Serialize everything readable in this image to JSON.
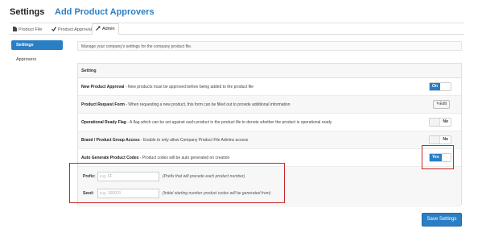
{
  "header": {
    "title": "Settings",
    "subtitle": "Add Product Approvers"
  },
  "tabs": [
    {
      "label": "Product File",
      "icon": "file-icon"
    },
    {
      "label": "Product Approval",
      "icon": "check-icon"
    },
    {
      "label": "Admin",
      "icon": "wrench-icon",
      "active": true
    }
  ],
  "sidebar": {
    "items": [
      {
        "label": "Settings",
        "active": true
      },
      {
        "label": "Approvers"
      }
    ]
  },
  "intro": "Manage your company's settings for the company product file.",
  "panel": {
    "heading": "Setting",
    "rows": [
      {
        "name": "New Product Approval",
        "desc": " - New products must be approved before being added to the product file",
        "control": "On"
      },
      {
        "name": "Product Request Form",
        "desc": " - When requesting a new product, this form can be filled out to provide additional information",
        "control": "Edit"
      },
      {
        "name": "Operational Ready Flag",
        "desc": " - A flag which can be set against each product in the product file to denote whether the product is operational ready",
        "control": "No"
      },
      {
        "name": "Brand / Product Group Access",
        "desc": " - Enable to only allow Company Product File Admins access",
        "control": "No"
      },
      {
        "name": "Auto Generate Product Codes",
        "desc": " - Product codes will be auto generated on creation",
        "control": "Yes"
      }
    ],
    "prefix": {
      "label": "Prefix:",
      "placeholder": "e.g. FF",
      "hint": "(Prefix that will precede each product number)"
    },
    "seed": {
      "label": "Seed:",
      "placeholder": "e.g. 100001",
      "hint": "(Initial starting number product codes will be generated from)"
    }
  },
  "save_label": "Save Settings",
  "colors": {
    "accent": "#2a7fc4",
    "highlight": "#c62828"
  }
}
